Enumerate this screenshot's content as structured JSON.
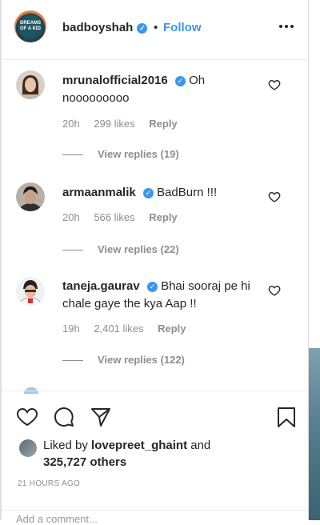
{
  "post": {
    "username": "badboyshah",
    "follow_label": "Follow",
    "dot": "•",
    "more_label": "•••",
    "avatar_text": "DREAMS OF A KID"
  },
  "comments": [
    {
      "username": "mrunalofficial2016",
      "text": "Oh nooooooooo",
      "time": "20h",
      "likes": "299 likes",
      "reply_label": "Reply",
      "view_replies": "View replies (19)",
      "avatar_icon": "woman-avatar"
    },
    {
      "username": "armaanmalik",
      "text": "BadBurn !!!",
      "time": "20h",
      "likes": "566 likes",
      "reply_label": "Reply",
      "view_replies": "View replies (22)",
      "avatar_icon": "man-avatar"
    },
    {
      "username": "taneja.gaurav",
      "text": "Bhai sooraj pe hi chale gaye the kya Aap !!",
      "time": "19h",
      "likes": "2,401 likes",
      "reply_label": "Reply",
      "view_replies": "View replies (122)",
      "avatar_icon": "cartoon-avatar"
    }
  ],
  "actions": {
    "liked_by_prefix": "Liked by",
    "liked_by_user": "lovepreet_ghaint",
    "liked_by_and": "and",
    "liked_by_others": "325,727 others",
    "time_ago": "21 HOURS AGO",
    "add_comment_placeholder": "Add a comment..."
  },
  "colors": {
    "accent": "#3897f0",
    "text": "#262626",
    "muted": "#8e8e8e"
  }
}
